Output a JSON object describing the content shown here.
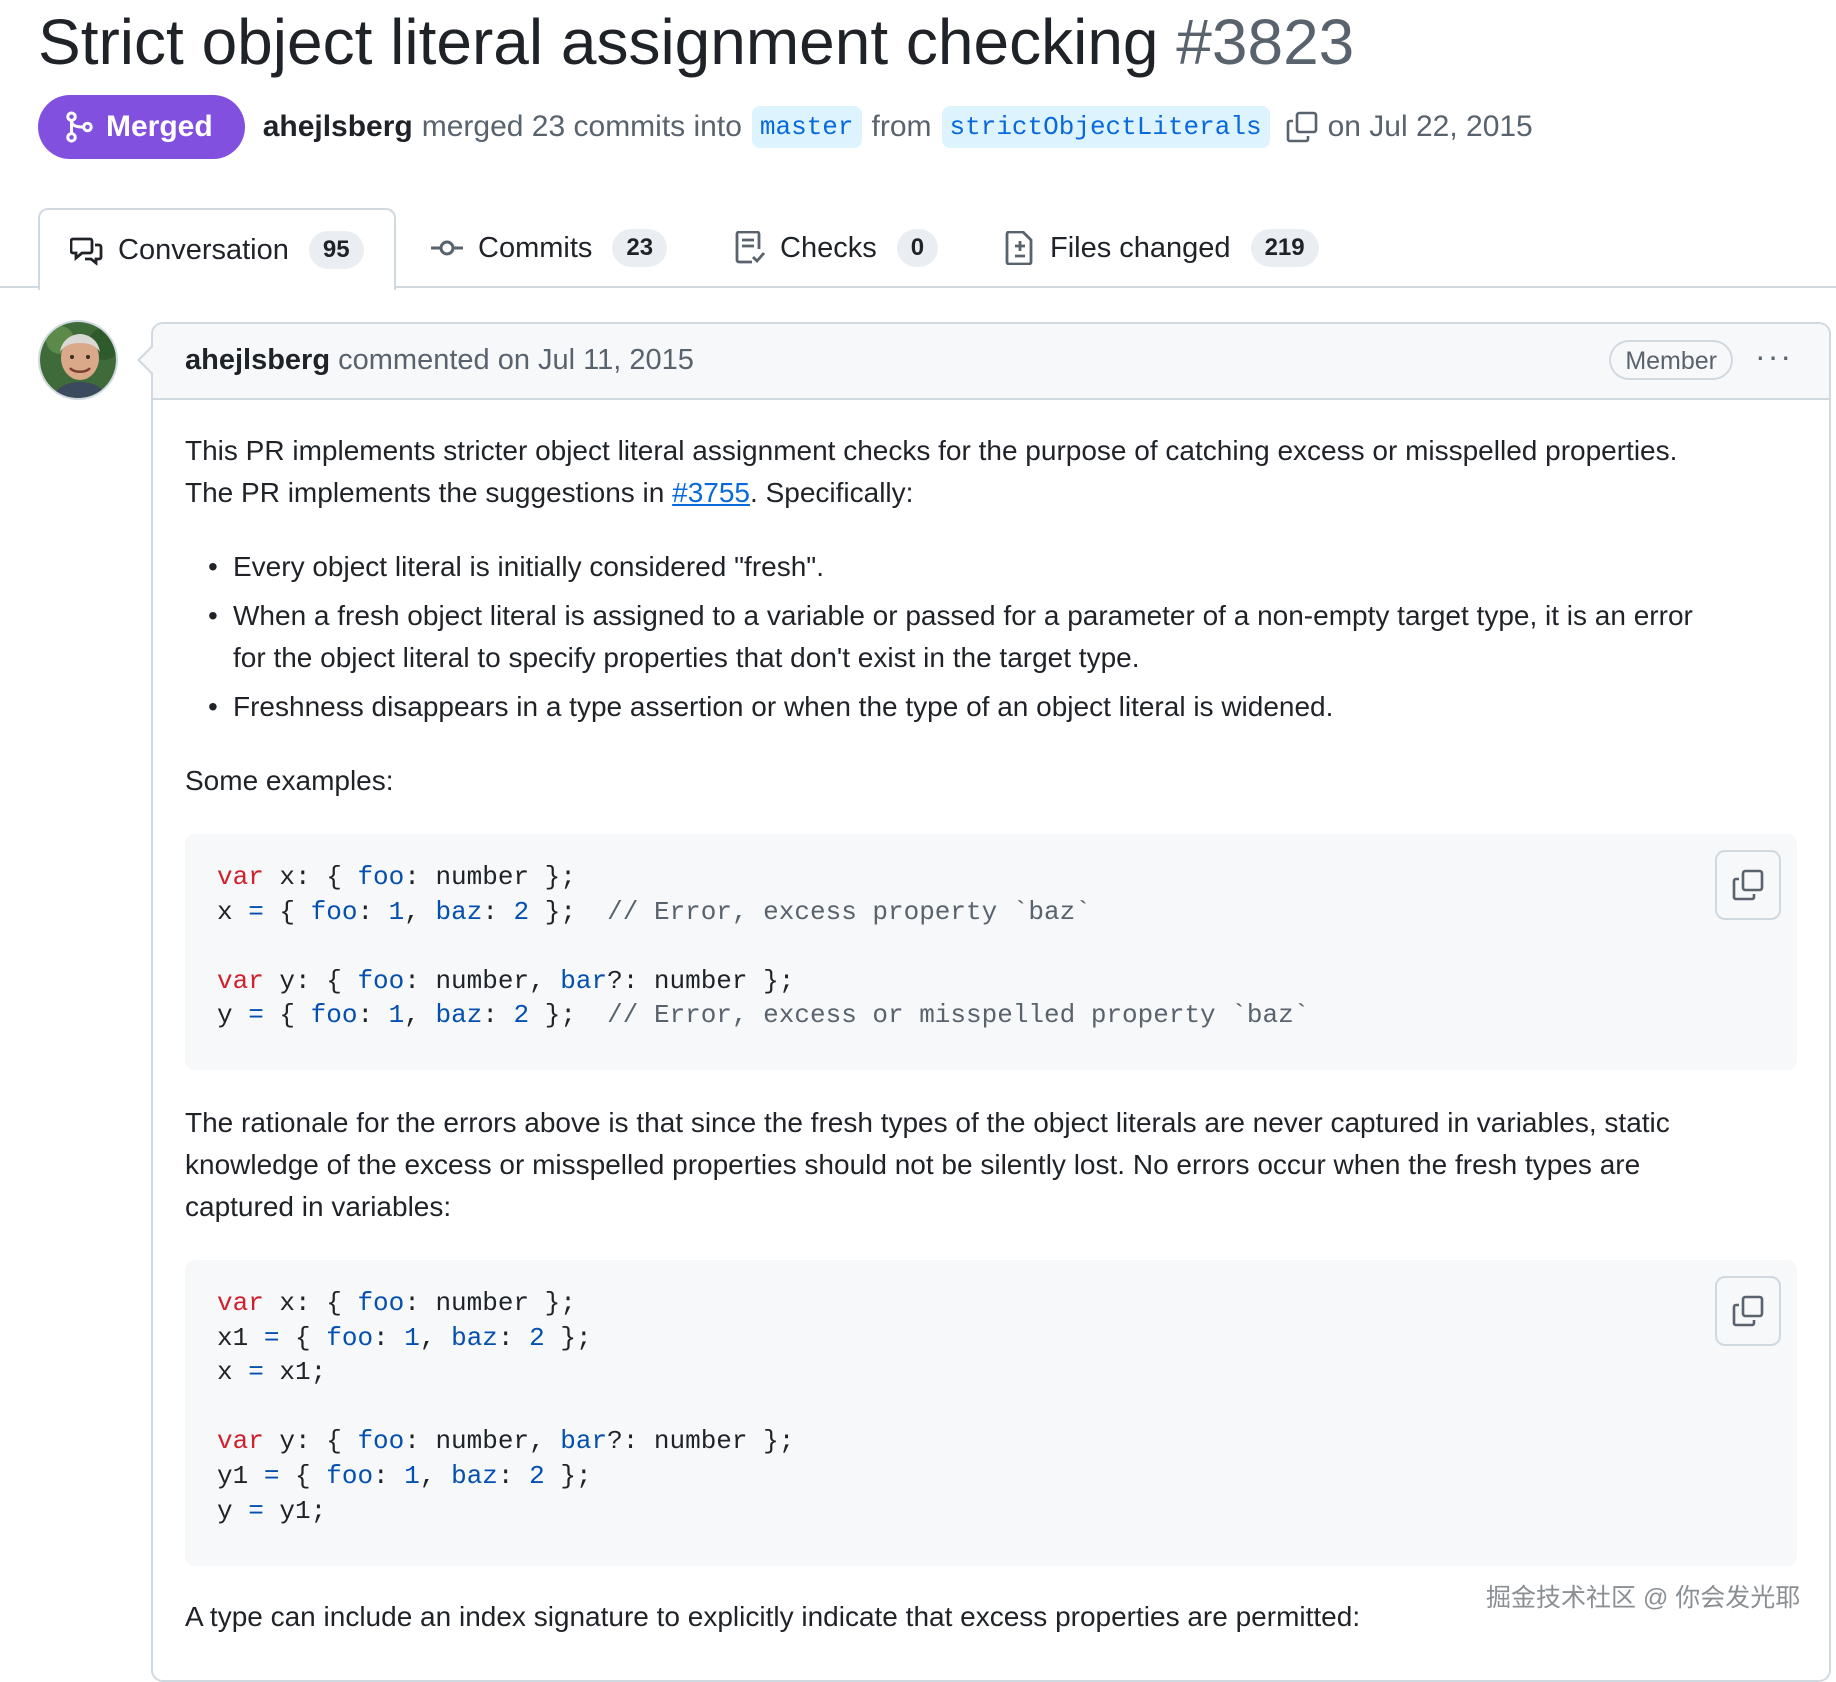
{
  "pr": {
    "title": "Strict object literal assignment checking",
    "number": "#3823",
    "state_label": "Merged",
    "author": "ahejlsberg",
    "merge_text": "merged 23 commits into",
    "base_branch": "master",
    "from_text": "from",
    "head_branch": "strictObjectLiterals",
    "date_text": "on Jul 22, 2015"
  },
  "tabs": [
    {
      "label": "Conversation",
      "count": "95",
      "icon": "comment-discussion-icon"
    },
    {
      "label": "Commits",
      "count": "23",
      "icon": "git-commit-icon"
    },
    {
      "label": "Checks",
      "count": "0",
      "icon": "checklist-icon"
    },
    {
      "label": "Files changed",
      "count": "219",
      "icon": "file-diff-icon"
    }
  ],
  "comment": {
    "author": "ahejlsberg",
    "action": "commented on Jul 11, 2015",
    "role_badge": "Member",
    "menu_label": "···",
    "para1_line1": "This PR implements stricter object literal assignment checks for the purpose of catching excess or misspelled properties.",
    "para1_line2_prefix": "The PR implements the suggestions in ",
    "para1_link": "#3755",
    "para1_line2_suffix": ". Specifically:",
    "bullets": [
      "Every object literal is initially considered \"fresh\".",
      "When a fresh object literal is assigned to a variable or passed for a parameter of a non-empty target type, it is an error",
      "for the object literal to specify properties that don't exist in the target type.",
      "Freshness disappears in a type assertion or when the type of an object literal is widened."
    ],
    "examples_label": "Some examples:",
    "code1": [
      "var x: { foo: number };",
      "x = { foo: 1, baz: 2 };  // Error, excess property `baz`",
      "",
      "var y: { foo: number, bar?: number };",
      "y = { foo: 1, baz: 2 };  // Error, excess or misspelled property `baz`"
    ],
    "rationale_lines": [
      "The rationale for the errors above is that since the fresh types of the object literals are never captured in variables, static",
      "knowledge of the excess or misspelled properties should not be silently lost. No errors occur when the fresh types are",
      "captured in variables:"
    ],
    "code2": [
      "var x: { foo: number };",
      "x1 = { foo: 1, baz: 2 };",
      "x = x1;",
      "",
      "var y: { foo: number, bar?: number };",
      "y1 = { foo: 1, baz: 2 };",
      "y = y1;"
    ],
    "index_sig_text": "A type can include an index signature to explicitly indicate that excess properties are permitted:"
  },
  "watermark": "掘金技术社区 @ 你会发光耶",
  "colors": {
    "merged": "#8250df",
    "link": "#0969da",
    "keyword": "#cf222e",
    "property": "#0550ae",
    "comment": "#59636e"
  }
}
